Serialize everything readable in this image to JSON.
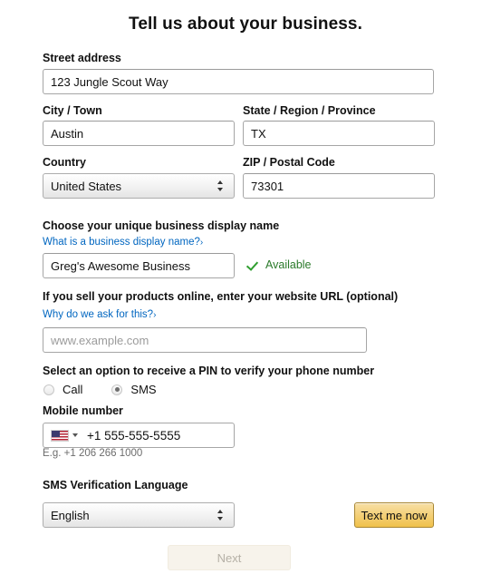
{
  "page": {
    "title": "Tell us about your business."
  },
  "form": {
    "street": {
      "label": "Street address",
      "value": "123 Jungle Scout Way",
      "placeholder": ""
    },
    "city": {
      "label": "City / Town",
      "value": "Austin",
      "placeholder": ""
    },
    "state": {
      "label": "State / Region / Province",
      "value": "TX",
      "placeholder": ""
    },
    "country": {
      "label": "Country",
      "value": "United States",
      "options": [
        "United States"
      ]
    },
    "zip": {
      "label": "ZIP / Postal Code",
      "value": "73301",
      "placeholder": ""
    },
    "display_name": {
      "label": "Choose your unique business display name",
      "help_link": "What is a business display name?",
      "help_chevron": "›",
      "value": "Greg's Awesome Business",
      "placeholder": "",
      "status_text": "Available",
      "status_icon": "check-icon",
      "status_color": "#2a7a2a"
    },
    "website": {
      "label": "If you sell your products online, enter your website URL (optional)",
      "help_link": "Why do we ask for this?",
      "help_chevron": "›",
      "value": "",
      "placeholder": "www.example.com"
    },
    "pin_method": {
      "label": "Select an option to receive a PIN to verify your phone number",
      "options": [
        {
          "label": "Call",
          "selected": false
        },
        {
          "label": "SMS",
          "selected": true
        }
      ]
    },
    "mobile": {
      "label": "Mobile number",
      "country_flag": "us-flag-icon",
      "value": "+1 555-555-5555",
      "hint": "E.g. +1 206 266 1000"
    },
    "sms_language": {
      "label": "SMS Verification Language",
      "value": "English",
      "options": [
        "English"
      ]
    }
  },
  "actions": {
    "text_me_now": "Text me now",
    "next": "Next"
  },
  "colors": {
    "link": "#0066c0",
    "gold_button_top": "#f7dfa5",
    "gold_button_bottom": "#f0c14b",
    "gold_button_border": "#a88734",
    "available_green": "#2a7a2a",
    "disabled_button_bg": "#f7f3eb",
    "disabled_button_text": "#b5b0a6"
  }
}
